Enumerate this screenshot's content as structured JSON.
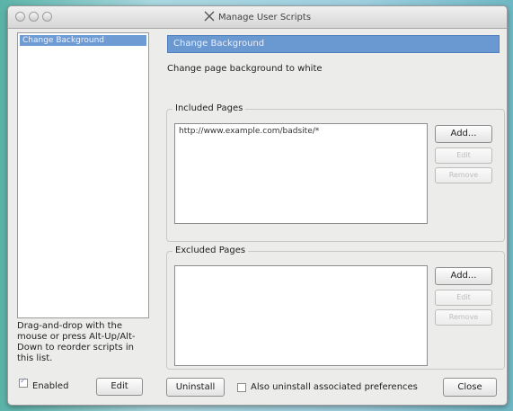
{
  "window": {
    "title": "Manage User Scripts"
  },
  "sidebar": {
    "scripts": [
      {
        "label": "Change Background"
      }
    ],
    "hint": "Drag-and-drop with the mouse or press Alt-Up/Alt-Down to reorder scripts in this list.",
    "enabled_label": "Enabled",
    "enabled_checked": true,
    "edit_label": "Edit"
  },
  "detail": {
    "script_name": "Change Background",
    "description": "Change page background to white",
    "included": {
      "label": "Included Pages",
      "pages": [
        "http://www.example.com/badsite/*"
      ],
      "add_label": "Add...",
      "edit_label": "Edit",
      "remove_label": "Remove"
    },
    "excluded": {
      "label": "Excluded Pages",
      "pages": [],
      "add_label": "Add...",
      "edit_label": "Edit",
      "remove_label": "Remove"
    }
  },
  "footer": {
    "uninstall_label": "Uninstall",
    "also_uninstall_label": "Also uninstall associated preferences",
    "also_uninstall_checked": false,
    "close_label": "Close"
  },
  "colors": {
    "selection": "#6e9bd3",
    "window_bg": "#ececea"
  }
}
